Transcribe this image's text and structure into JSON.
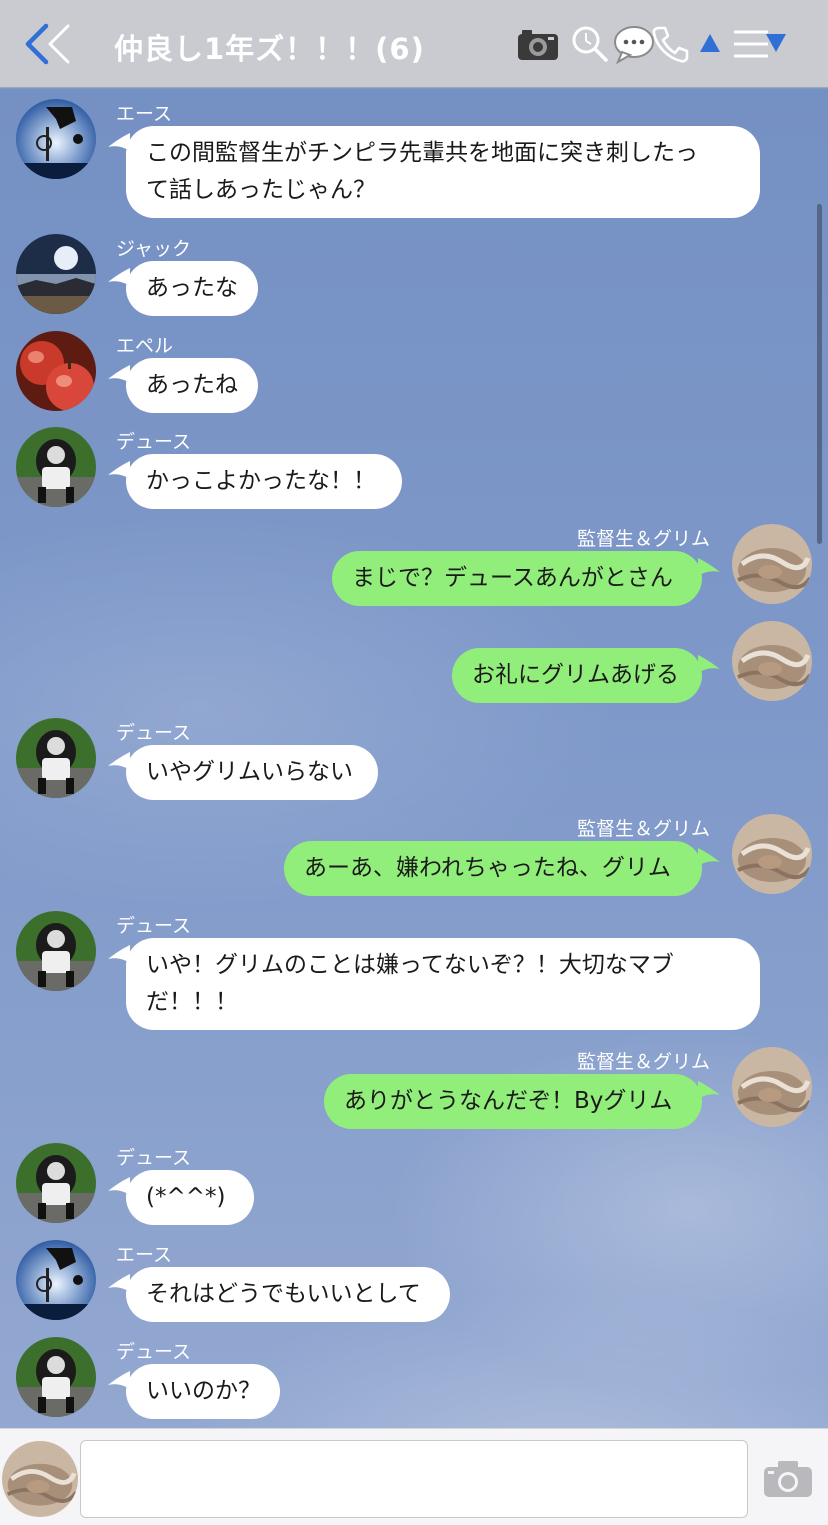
{
  "header": {
    "title": "仲良し1年ズ！！！(6)",
    "icons": [
      "back-chevron-icon",
      "camera-icon",
      "search-icon",
      "chat-icon",
      "phone-icon",
      "collapse-up-icon",
      "menu-icon"
    ]
  },
  "messages": [
    {
      "side": "in",
      "sender": "エース",
      "avatar": "ace",
      "lines": [
        "この間監督生がチンピラ先輩共を地面に突き刺したっ",
        "て話しあったじゃん？"
      ]
    },
    {
      "side": "in",
      "sender": "ジャック",
      "avatar": "jack",
      "lines": [
        "あったな"
      ]
    },
    {
      "side": "in",
      "sender": "エペル",
      "avatar": "epel",
      "lines": [
        "あったね"
      ]
    },
    {
      "side": "in",
      "sender": "デュース",
      "avatar": "deuce",
      "lines": [
        "かっこよかったな！！"
      ]
    },
    {
      "side": "out",
      "sender": "監督生＆グリム",
      "avatar": "me",
      "lines": [
        "まじで？デュースあんがとさん"
      ]
    },
    {
      "side": "out",
      "sender": "",
      "avatar": "me",
      "lines": [
        "お礼にグリムあげる"
      ]
    },
    {
      "side": "in",
      "sender": "デュース",
      "avatar": "deuce",
      "lines": [
        "いやグリムいらない"
      ]
    },
    {
      "side": "out",
      "sender": "監督生＆グリム",
      "avatar": "me",
      "lines": [
        "あーあ、嫌われちゃったね、グリム"
      ]
    },
    {
      "side": "in",
      "sender": "デュース",
      "avatar": "deuce",
      "lines": [
        "いや！グリムのことは嫌ってないぞ？！大切なマブ",
        "だ！！！"
      ]
    },
    {
      "side": "out",
      "sender": "監督生＆グリム",
      "avatar": "me",
      "lines": [
        "ありがとうなんだぞ！Byグリム"
      ]
    },
    {
      "side": "in",
      "sender": "デュース",
      "avatar": "deuce",
      "lines": [
        "(*^^*)"
      ]
    },
    {
      "side": "in",
      "sender": "エース",
      "avatar": "ace",
      "lines": [
        "それはどうでもいいとして"
      ]
    },
    {
      "side": "in",
      "sender": "デュース",
      "avatar": "deuce",
      "lines": [
        "いいのか？"
      ]
    }
  ],
  "composer": {
    "value": "",
    "icons": [
      "user-avatar-icon",
      "camera-icon"
    ]
  },
  "colors": {
    "header_bg": "#c9cbd0",
    "chat_bg": "#7f97c6",
    "incoming_bubble": "#ffffff",
    "outgoing_bubble": "#92ee7a",
    "accent": "#2f6fd6"
  }
}
